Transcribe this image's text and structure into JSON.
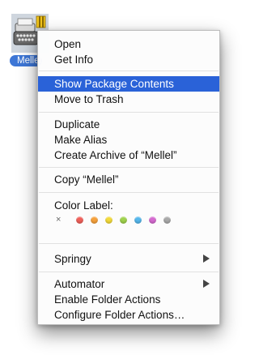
{
  "file": {
    "name": "Mellel",
    "icon": "typewriter-app-icon"
  },
  "context_menu": {
    "group1": [
      "Open",
      "Get Info"
    ],
    "group2": [
      "Show Package Contents",
      "Move to Trash"
    ],
    "group3": [
      "Duplicate",
      "Make Alias",
      "Create Archive of “Mellel”"
    ],
    "group4": [
      "Copy “Mellel”"
    ],
    "color_label": {
      "title": "Color Label:",
      "none_glyph": "×",
      "colors": [
        "#f0605a",
        "#f6a13c",
        "#f3da3a",
        "#9fd24d",
        "#55b7ec",
        "#d56ad0",
        "#a9a9a9"
      ]
    },
    "group6": [
      "Springy"
    ],
    "group7": [
      "Automator",
      "Enable Folder Actions",
      "Configure Folder Actions…"
    ],
    "highlighted_item": "Show Package Contents"
  }
}
